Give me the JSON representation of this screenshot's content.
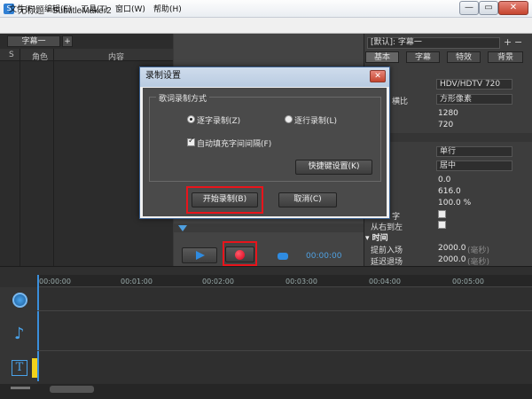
{
  "window": {
    "title": "无标题 - SubtitleMaker2",
    "min": "—",
    "restore": "▭",
    "close": "✕"
  },
  "menu": [
    "文件(F)",
    "编辑(E)",
    "工具(T)",
    "窗口(W)",
    "帮助(H)"
  ],
  "left_panel": {
    "tab": "字幕一",
    "tab_add": "+",
    "columns": [
      "S",
      "角色",
      "内容"
    ]
  },
  "right_panel": {
    "preset": "[默认]: 字幕一",
    "tabs": [
      "基本",
      "字幕",
      "特效",
      "背景"
    ],
    "rows": [
      {
        "label": "",
        "value": "HDV/HDTV 720"
      },
      {
        "label": "横比",
        "value": "方形像素"
      },
      {
        "label": "",
        "value": "1280"
      },
      {
        "label": "",
        "value": "720"
      },
      {
        "label": "",
        "value": "单行"
      },
      {
        "label": "",
        "value": "居中"
      },
      {
        "label": "",
        "value": "0.0"
      },
      {
        "label": "",
        "value": "616.0"
      },
      {
        "label": "",
        "value": "100.0 %"
      },
      {
        "label": "字",
        "value": ""
      },
      {
        "label": "从右到左",
        "value": ""
      }
    ],
    "section_time": "时间",
    "time_rows": [
      {
        "label": "提前入场",
        "value": "2000.0",
        "unit": "(毫秒)"
      },
      {
        "label": "延迟退场",
        "value": "2000.0",
        "unit": "(毫秒)"
      }
    ]
  },
  "player": {
    "time": "00:00:00"
  },
  "timeline": {
    "ticks": [
      "00:00:00",
      "00:01:00",
      "00:02:00",
      "00:03:00",
      "00:04:00",
      "00:05:00"
    ]
  },
  "dialog": {
    "title": "录制设置",
    "close": "✕",
    "group_label": "歌词录制方式",
    "radio_char": "逐字录制(Z)",
    "radio_line": "逐行录制(L)",
    "auto_fill": "自动填充字间间隔(F)",
    "hotkey_button": "快捷键设置(K)",
    "start_button": "开始录制(B)",
    "cancel_button": "取消(C)"
  },
  "colors": {
    "accent_red": "#e8141b",
    "record": "#d9001b",
    "play": "#2f8be0"
  }
}
